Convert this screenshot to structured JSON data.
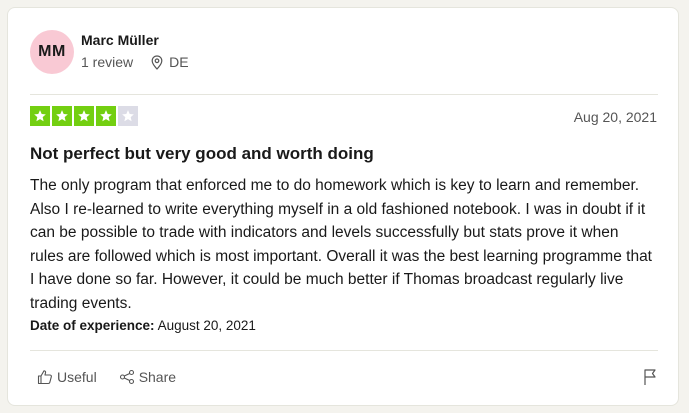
{
  "reviewer": {
    "initials": "MM",
    "name": "Marc Müller",
    "review_count": "1 review",
    "country": "DE",
    "avatar_color": "#f9c9d4"
  },
  "rating": {
    "stars": 4,
    "max": 5,
    "filled_color": "#73cf11",
    "empty_color": "#dcdce6",
    "date": "Aug 20, 2021"
  },
  "review": {
    "title": "Not perfect but very good and worth doing",
    "body": "The only program that enforced me to do homework which is key to learn and remember. Also I re-learned to write everything myself in a old fashioned notebook. I was in doubt if it can be possible to trade with indicators and levels successfully but stats prove it when rules are followed which is most important. Overall it was the best learning programme that I have done so far. However, it could be much better if Thomas broadcast regularly live trading events.",
    "experience_label": "Date of experience:",
    "experience_date": "August 20, 2021"
  },
  "actions": {
    "useful_label": "Useful",
    "share_label": "Share",
    "icons": [
      "thumbs-up-icon",
      "share-icon",
      "flag-icon"
    ]
  }
}
